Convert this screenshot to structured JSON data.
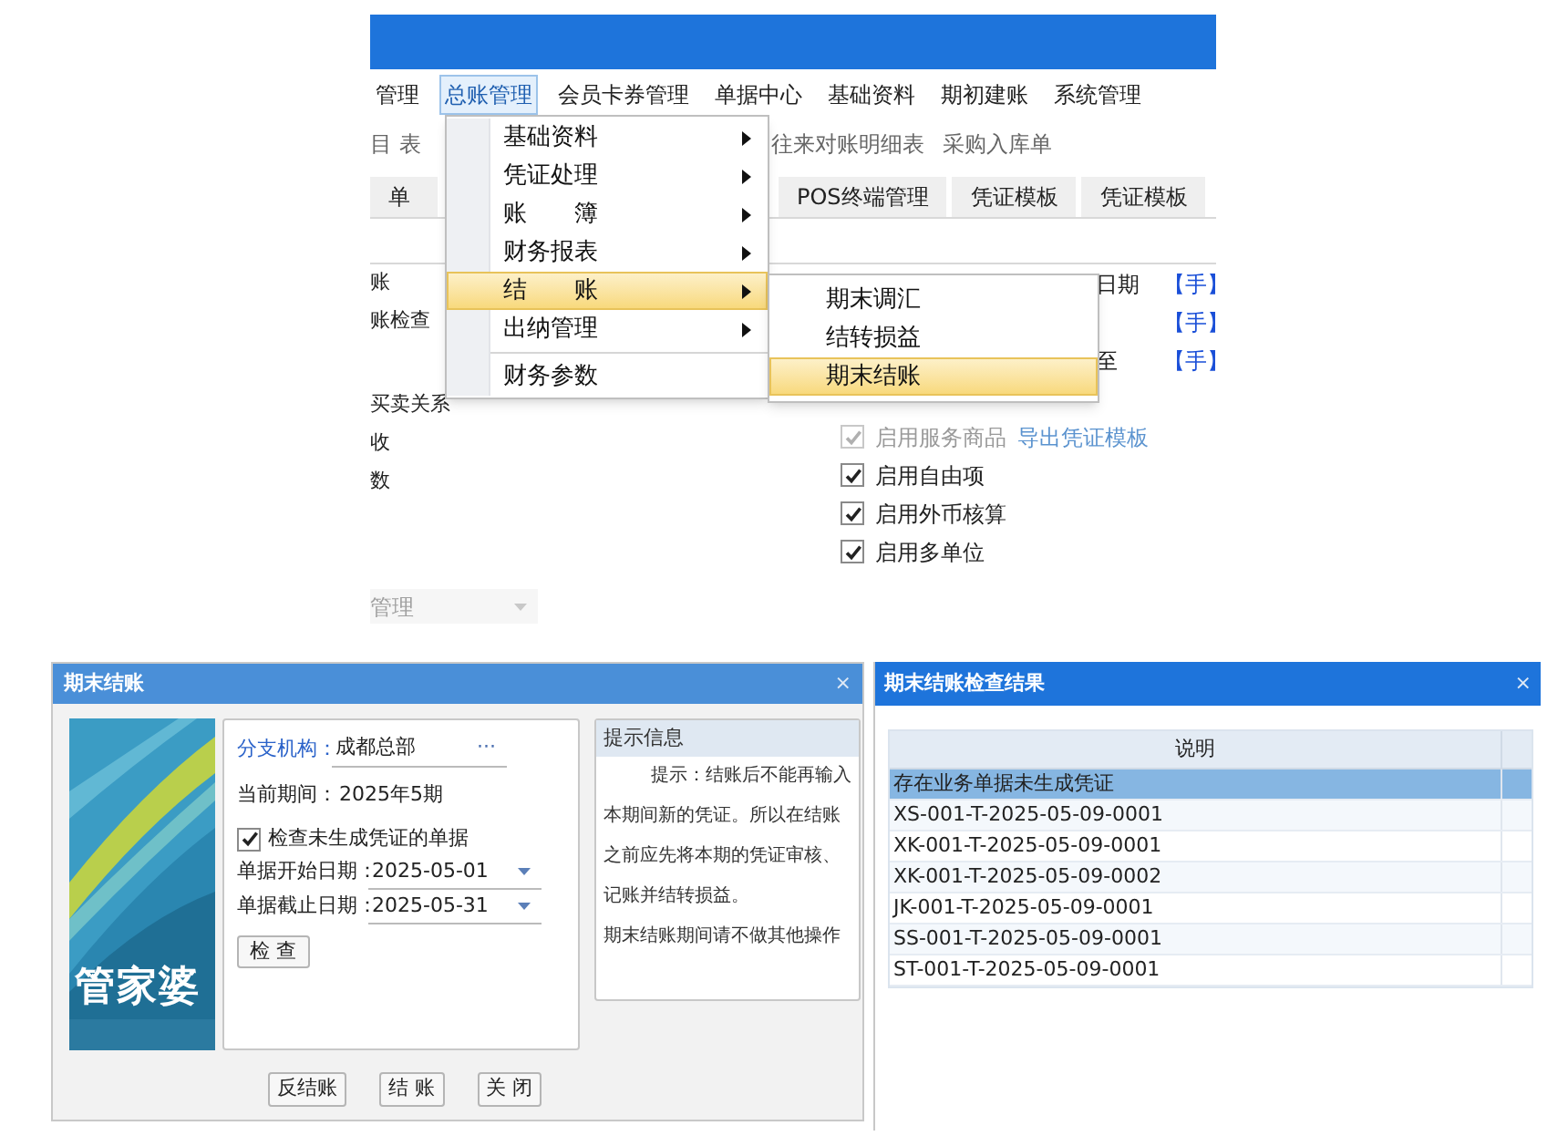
{
  "top_window": {
    "menu_bar": [
      {
        "label": "管理",
        "selected": false
      },
      {
        "label": "总账管理",
        "selected": true
      },
      {
        "label": "会员卡券管理",
        "selected": false
      },
      {
        "label": "单据中心",
        "selected": false
      },
      {
        "label": "基础资料",
        "selected": false
      },
      {
        "label": "期初建账",
        "selected": false
      },
      {
        "label": "系统管理",
        "selected": false
      }
    ],
    "toolbar_links": [
      "目 表",
      "往来对账明细表",
      "采购入库单"
    ],
    "tabs": [
      "单",
      "POS终端管理",
      "凭证模板",
      "凭证模板"
    ],
    "left_items": [
      "账",
      "账检查",
      "买卖关系",
      "收",
      "数"
    ],
    "right_rows": [
      {
        "kind": "link",
        "label": "日期",
        "link": "【手】"
      },
      {
        "kind": "link",
        "link": "【手】"
      },
      {
        "kind": "link",
        "label": "至",
        "link": "【手】"
      },
      {
        "kind": "checkbox",
        "label": "启用服务商品",
        "checked": true,
        "disabled": true,
        "link": "导出凭证模板"
      },
      {
        "kind": "checkbox",
        "label": "启用自由项",
        "checked": true,
        "disabled": false
      },
      {
        "kind": "checkbox",
        "label": "启用外币核算",
        "checked": true,
        "disabled": false
      },
      {
        "kind": "checkbox",
        "label": "启用多单位",
        "checked": true,
        "disabled": false
      }
    ],
    "dropdown": {
      "value": "管理",
      "disabled": true
    },
    "menu": [
      {
        "label": "基础资料",
        "has_submenu": true,
        "selected": false
      },
      {
        "label": "凭证处理",
        "has_submenu": true,
        "selected": false
      },
      {
        "label": "账　　簿",
        "has_submenu": true,
        "selected": false
      },
      {
        "label": "财务报表",
        "has_submenu": true,
        "selected": false
      },
      {
        "label": "结　　账",
        "has_submenu": true,
        "selected": true
      },
      {
        "label": "出纳管理",
        "has_submenu": true,
        "selected": false
      },
      {
        "label": "财务参数",
        "has_submenu": false,
        "selected": false,
        "separator_before": true
      }
    ],
    "submenu": [
      {
        "label": "期末调汇",
        "selected": false
      },
      {
        "label": "结转损益",
        "selected": false
      },
      {
        "label": "期末结账",
        "selected": true
      }
    ]
  },
  "closing_dialog": {
    "title": "期末结账",
    "close": "×",
    "brand_text": "管家婆",
    "branch_label": "分支机构：",
    "branch_value": "成都总部",
    "branch_more": "···",
    "period_label": "当前期间：",
    "period_value": "2025年5期",
    "check_option": {
      "label": "检查未生成凭证的单据",
      "checked": true
    },
    "start_label": "单据开始日期：",
    "start_value": "2025-05-01",
    "end_label": "单据截止日期：",
    "end_value": "2025-05-31",
    "check_button": "检 查",
    "hint_title": "提示信息",
    "hint_paragraphs": [
      "提示：结账后不能再输入本期间新的凭证。所以在结账之前应先将本期的凭证审核、记账并结转损益。",
      "期末结账期间请不做其他操作"
    ],
    "buttons": [
      "反结账",
      "结 账",
      "关 闭"
    ]
  },
  "result_dialog": {
    "title": "期末结账检查结果",
    "close": "×",
    "column": "说明",
    "rows": [
      {
        "text": "存在业务单据未生成凭证",
        "selected": true
      },
      {
        "text": "XS-001-T-2025-05-09-0001",
        "selected": false
      },
      {
        "text": "XK-001-T-2025-05-09-0001",
        "selected": false
      },
      {
        "text": "XK-001-T-2025-05-09-0002",
        "selected": false
      },
      {
        "text": "JK-001-T-2025-05-09-0001",
        "selected": false
      },
      {
        "text": "SS-001-T-2025-05-09-0001",
        "selected": false
      },
      {
        "text": "ST-001-T-2025-05-09-0001",
        "selected": false
      }
    ]
  }
}
